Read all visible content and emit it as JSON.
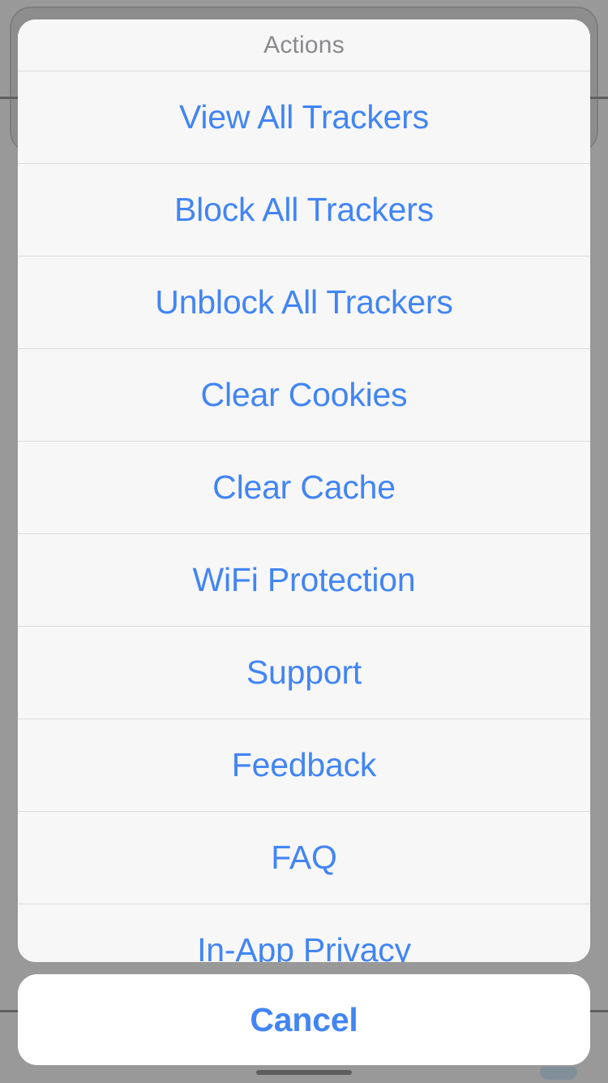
{
  "colors": {
    "accent_blue": "#4285f4",
    "header_gray": "#8a8a8e",
    "sheet_background": "#f7f7f7",
    "cancel_background": "#ffffff",
    "dimmed_backdrop": "#999999",
    "separator": "#dcdcdc"
  },
  "action_sheet": {
    "header": {
      "title": "Actions"
    },
    "items": [
      {
        "label": "View All Trackers"
      },
      {
        "label": "Block All Trackers"
      },
      {
        "label": "Unblock All Trackers"
      },
      {
        "label": "Clear Cookies"
      },
      {
        "label": "Clear Cache"
      },
      {
        "label": "WiFi Protection"
      },
      {
        "label": "Support"
      },
      {
        "label": "Feedback"
      },
      {
        "label": "FAQ"
      },
      {
        "label": "In-App Privacy"
      }
    ]
  },
  "cancel": {
    "label": "Cancel"
  }
}
